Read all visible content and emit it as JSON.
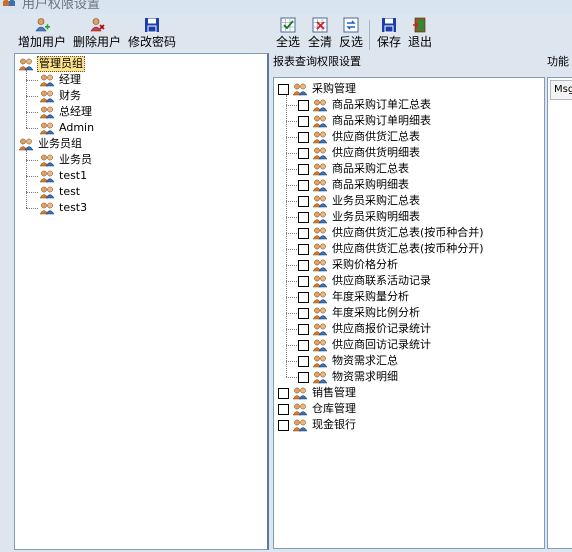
{
  "window": {
    "title": "用户权限设置"
  },
  "user_toolbar": {
    "add_user": "增加用户",
    "delete_user": "删除用户",
    "change_password": "修改密码"
  },
  "perm_toolbar": {
    "select_all": "全选",
    "clear_all": "全清",
    "invert": "反选",
    "save": "保存",
    "exit": "退出"
  },
  "user_tree": [
    {
      "label": "管理员组",
      "selected": true,
      "children": [
        "经理",
        "财务",
        "总经理",
        "Admin"
      ]
    },
    {
      "label": "业务员组",
      "selected": false,
      "children": [
        "业务员",
        "test1",
        "test",
        "test3"
      ]
    }
  ],
  "report_section": {
    "label": "报表查询权限设置",
    "tree": [
      {
        "label": "采购管理",
        "children": [
          "商品采购订单汇总表",
          "商品采购订单明细表",
          "供应商供货汇总表",
          "供应商供货明细表",
          "商品采购汇总表",
          "商品采购明细表",
          "业务员采购汇总表",
          "业务员采购明细表",
          "供应商供货汇总表(按币种合并)",
          "供应商供货汇总表(按币种分开)",
          "采购价格分析",
          "供应商联系活动记录",
          "年度采购量分析",
          "年度采购比例分析",
          "供应商报价记录统计",
          "供应商回访记录统计",
          "物资需求汇总",
          "物资需求明细"
        ]
      },
      {
        "label": "销售管理",
        "children": []
      },
      {
        "label": "仓库管理",
        "children": []
      },
      {
        "label": "现金银行",
        "children": []
      }
    ]
  },
  "function_section": {
    "label": "功能",
    "grid_header": "Msg"
  },
  "colors": {
    "frame": "#dde5ef",
    "selection": "#ffe38a",
    "border": "#7f9db9"
  }
}
